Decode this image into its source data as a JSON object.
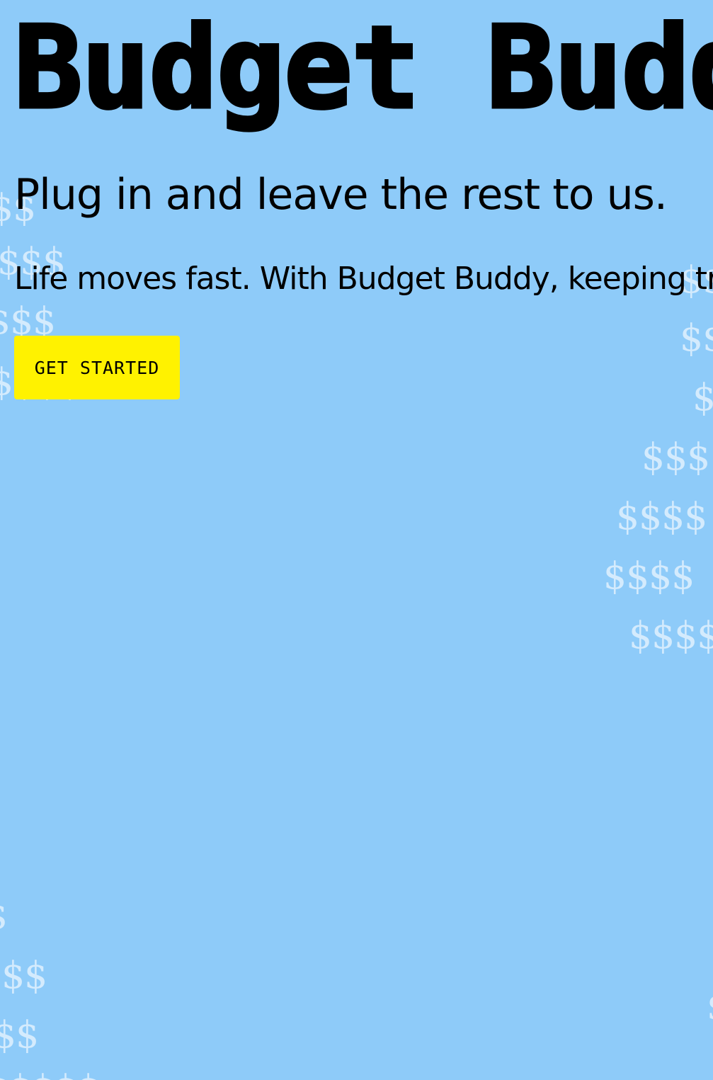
{
  "hero": {
    "title": "Budget Buddy",
    "subtitle": "Plug in and leave the rest to us.",
    "description": "Life moves fast. With Budget Buddy, keeping track of your spending is easy.",
    "cta_label": "GET STARTED"
  },
  "background": {
    "pattern_glyph": "$",
    "color": "#8ecbf9",
    "glyph_color": "#ffffff",
    "cta_color": "#fff200"
  }
}
